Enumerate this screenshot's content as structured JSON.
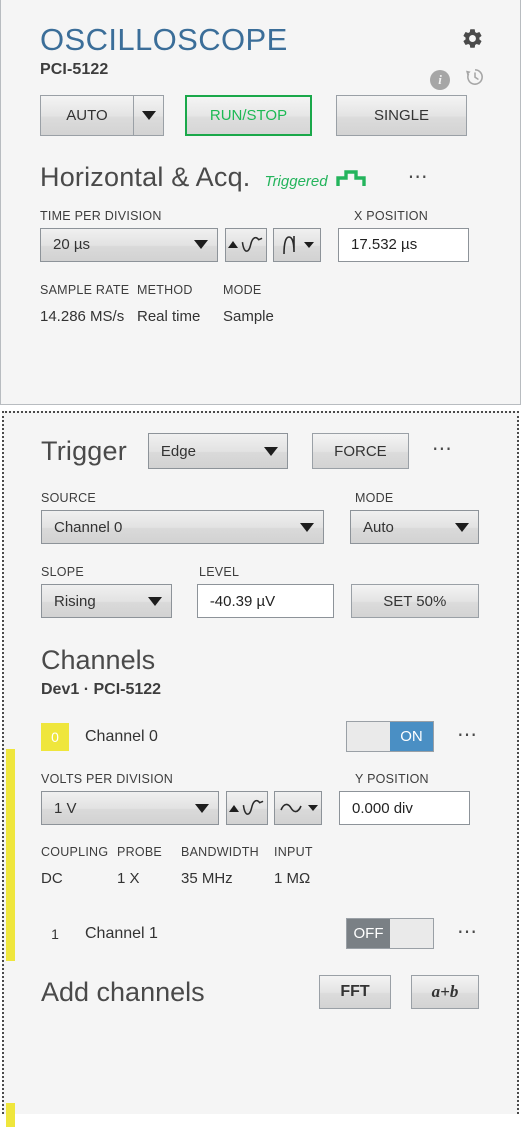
{
  "header": {
    "title": "OSCILLOSCOPE",
    "device": "PCI-5122",
    "gear_icon": "gear-icon",
    "info_icon": "info-icon",
    "info_glyph": "i",
    "history_icon": "history-icon"
  },
  "toolbar": {
    "auto_label": "AUTO",
    "auto_dropdown_icon": "chevron-down-icon",
    "run_stop_label": "RUN/STOP",
    "single_label": "SINGLE",
    "run_stop_color": "#1db954"
  },
  "horizontal": {
    "title": "Horizontal & Acq.",
    "status": "Triggered",
    "status_icon": "trigger-pulse-icon",
    "status_color": "#24b45c",
    "overflow_icon": "ellipsis-icon",
    "time_per_division": {
      "label": "TIME PER DIVISION",
      "value": "20 µs"
    },
    "autoscale_icon": "autoscale-wave-icon",
    "waveform_icon": "steep-wave-icon",
    "x_position": {
      "label": "X POSITION",
      "value": "17.532 µs"
    },
    "readouts": {
      "headers": [
        "SAMPLE RATE",
        "METHOD",
        "MODE"
      ],
      "values": [
        "14.286 MS/s",
        "Real time",
        "Sample"
      ]
    }
  },
  "trigger": {
    "title": "Trigger",
    "type_value": "Edge",
    "force_label": "FORCE",
    "overflow_icon": "ellipsis-icon",
    "source": {
      "label": "SOURCE",
      "value": "Channel 0"
    },
    "mode": {
      "label": "MODE",
      "value": "Auto"
    },
    "slope": {
      "label": "SLOPE",
      "value": "Rising"
    },
    "level": {
      "label": "LEVEL",
      "value": "-40.39 µV"
    },
    "set50_label": "SET 50%"
  },
  "channels": {
    "title": "Channels",
    "device_line": "Dev1  ·  PCI-5122",
    "accent_color": "#efe63c",
    "channel0": {
      "badge": "0",
      "name": "Channel 0",
      "toggle_state": "ON",
      "toggle_on_color": "#4a8fc4",
      "overflow_icon": "ellipsis-icon",
      "volts_per_division": {
        "label": "VOLTS PER DIVISION",
        "value": "1 V"
      },
      "autoscale_icon": "autoscale-wave-icon",
      "waveform_icon": "flat-wave-icon",
      "y_position": {
        "label": "Y POSITION",
        "value": "0.000 div"
      },
      "readouts": {
        "headers": [
          "COUPLING",
          "PROBE",
          "BANDWIDTH",
          "INPUT"
        ],
        "values": [
          "DC",
          "1 X",
          "35 MHz",
          "1 MΩ"
        ]
      }
    },
    "channel1": {
      "badge": "1",
      "name": "Channel 1",
      "toggle_state": "OFF",
      "overflow_icon": "ellipsis-icon"
    }
  },
  "add_channels": {
    "title": "Add channels",
    "fft_label": "FFT",
    "ab_label": "a+b"
  }
}
